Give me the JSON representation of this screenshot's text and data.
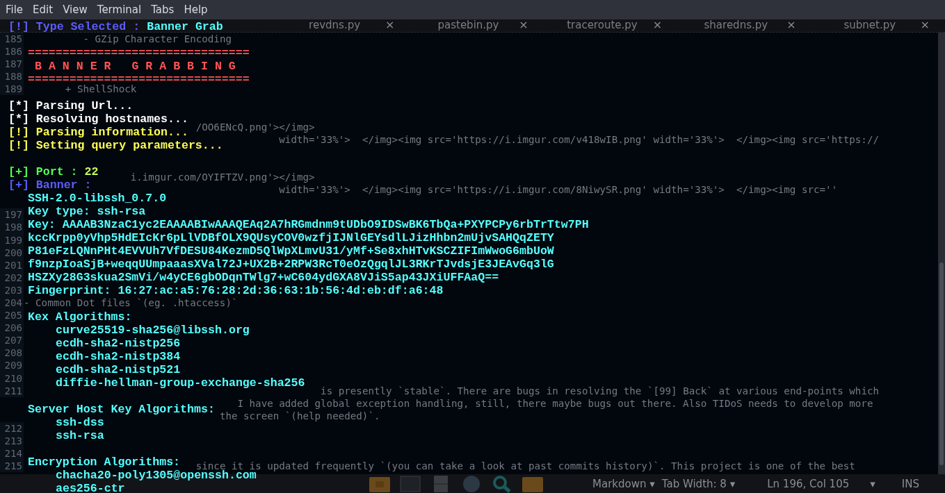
{
  "editor": {
    "tabs": [
      {
        "label": "revdns.py",
        "selected": false
      },
      {
        "label": "pastebin.py",
        "selected": false
      },
      {
        "label": "traceroute.py",
        "selected": false
      },
      {
        "label": "sharedns.py",
        "selected": false
      },
      {
        "label": "subnet.py",
        "selected": false
      }
    ],
    "close_glyph": "×",
    "lines": [
      {
        "number": "185",
        "text": "          - GZip Character Encoding"
      },
      {
        "number": "186"
      },
      {
        "number": "187"
      },
      {
        "number": "188"
      },
      {
        "number": "189",
        "text": "       + ShellShock"
      },
      {
        "kind": "covered"
      },
      {
        "kind": "covered"
      },
      {
        "text": "                             /OO6ENcQ.png'></img>"
      },
      {
        "text": "                                           width='33%'>  </img><img src='https://i.imgur.com/v418wIB.png' width='33%'>  </img><img src='https://"
      },
      {
        "kind": "covered"
      },
      {
        "kind": "covered"
      },
      {
        "text": "                  i.imgur.com/OYIFTZV.png'></img>"
      },
      {
        "text": "                                           width='33%'>  </img><img src='https://i.imgur.com/8NiwySR.png' width='33%'>  </img><img src=''"
      },
      {
        "kind": "covered"
      },
      {
        "number": "197"
      },
      {
        "number": "198"
      },
      {
        "number": "199"
      },
      {
        "number": "200"
      },
      {
        "number": "201"
      },
      {
        "number": "202"
      },
      {
        "number": "203"
      },
      {
        "number": "204",
        "text": "- Common Dot files `(eg. .htaccess)`"
      },
      {
        "number": "205"
      },
      {
        "number": "206"
      },
      {
        "number": "207"
      },
      {
        "number": "208"
      },
      {
        "number": "209"
      },
      {
        "number": "210"
      },
      {
        "number": "211",
        "text": "                                                  is presently `stable`. There are bugs in resolving the `[99] Back` at various end-points which"
      },
      {
        "text": "                                    I have added global exception handling, still, there maybe bugs out there. Also TIDoS needs to develop more"
      },
      {
        "text": "                                 the screen `(help needed)`."
      },
      {
        "number": "212"
      },
      {
        "number": "213"
      },
      {
        "number": "214"
      },
      {
        "number": "215",
        "text": "                             since it is updated frequently `(you can take a look at past commits history)`. This project is one of the best"
      }
    ],
    "status_bar": {
      "mode": "Markdown",
      "tab_width": "Tab Width: 8",
      "position": "Ln 196, Col 105",
      "caret": "▾",
      "insert": "INS"
    }
  },
  "terminal": {
    "menu": [
      "File",
      "Edit",
      "View",
      "Terminal",
      "Tabs",
      "Help"
    ],
    "lines": [
      {
        "kind": "notice",
        "text": "[!] Type Selected : ",
        "value": "Banner Grab"
      },
      {
        "kind": "blank"
      },
      {
        "kind": "rule",
        "text": "================================"
      },
      {
        "kind": "title",
        "text": "B A N N E R   G R A B B I N G"
      },
      {
        "kind": "rule",
        "text": "================================"
      },
      {
        "kind": "blank"
      },
      {
        "kind": "info",
        "text": "[*] Parsing Url..."
      },
      {
        "kind": "info",
        "text": "[*] Resolving hostnames..."
      },
      {
        "kind": "warn",
        "text": "[!] Parsing information..."
      },
      {
        "kind": "warn",
        "text": "[!] Setting query parameters..."
      },
      {
        "kind": "blank"
      },
      {
        "kind": "ok",
        "text": "[+] Port : ",
        "value": "22"
      },
      {
        "kind": "section",
        "text": "[+] Banner :"
      },
      {
        "kind": "field",
        "text": "SSH-2.0-libssh_0.7.0"
      },
      {
        "kind": "field",
        "text": "Key type: ssh-rsa"
      },
      {
        "kind": "field",
        "text": "Key: AAAAB3NzaC1yc2EAAAABIwAAAQEAq2A7hRGmdnm9tUDbO9IDSwBK6TbQa+PXYPCPy6rbTrTtw7PH"
      },
      {
        "kind": "field",
        "text": "kccKrpp0yVhp5HdEIcKr6pLlVDBfOLX9QUsyCOV0wzfjIJNlGEYsdlLJizHhbn2mUjvSAHQqZETY"
      },
      {
        "kind": "field",
        "text": "P81eFzLQNnPHt4EVVUh7VfDESU84KezmD5QlWpXLmvU31/yMf+Se8xhHTvKSCZIFImWwoG6mbUoW"
      },
      {
        "kind": "field",
        "text": "f9nzpIoaSjB+weqqUUmpaaasXVal72J+UX2B+2RPW3RcT0eOzQgqlJL3RKrTJvdsjE3JEAvGq3lG"
      },
      {
        "kind": "field",
        "text": "HSZXy28G3skua2SmVi/w4yCE6gbODqnTWlg7+wC604ydGXA8VJiS5ap43JXiUFFAaQ=="
      },
      {
        "kind": "field",
        "text": "Fingerprint: 16:27:ac:a5:76:28:2d:36:63:1b:56:4d:eb:df:a6:48"
      },
      {
        "kind": "blank"
      },
      {
        "kind": "field",
        "text": "Kex Algorithms:"
      },
      {
        "kind": "item",
        "text": "curve25519-sha256@libssh.org"
      },
      {
        "kind": "item",
        "text": "ecdh-sha2-nistp256"
      },
      {
        "kind": "item",
        "text": "ecdh-sha2-nistp384"
      },
      {
        "kind": "item",
        "text": "ecdh-sha2-nistp521"
      },
      {
        "kind": "item",
        "text": "diffie-hellman-group-exchange-sha256"
      },
      {
        "kind": "blank"
      },
      {
        "kind": "field",
        "text": "Server Host Key Algorithms:"
      },
      {
        "kind": "item",
        "text": "ssh-dss"
      },
      {
        "kind": "item",
        "text": "ssh-rsa"
      },
      {
        "kind": "blank"
      },
      {
        "kind": "field",
        "text": "Encryption Algorithms:"
      },
      {
        "kind": "item",
        "text": "chacha20-poly1305@openssh.com"
      },
      {
        "kind": "item",
        "text": "aes256-ctr"
      }
    ]
  }
}
